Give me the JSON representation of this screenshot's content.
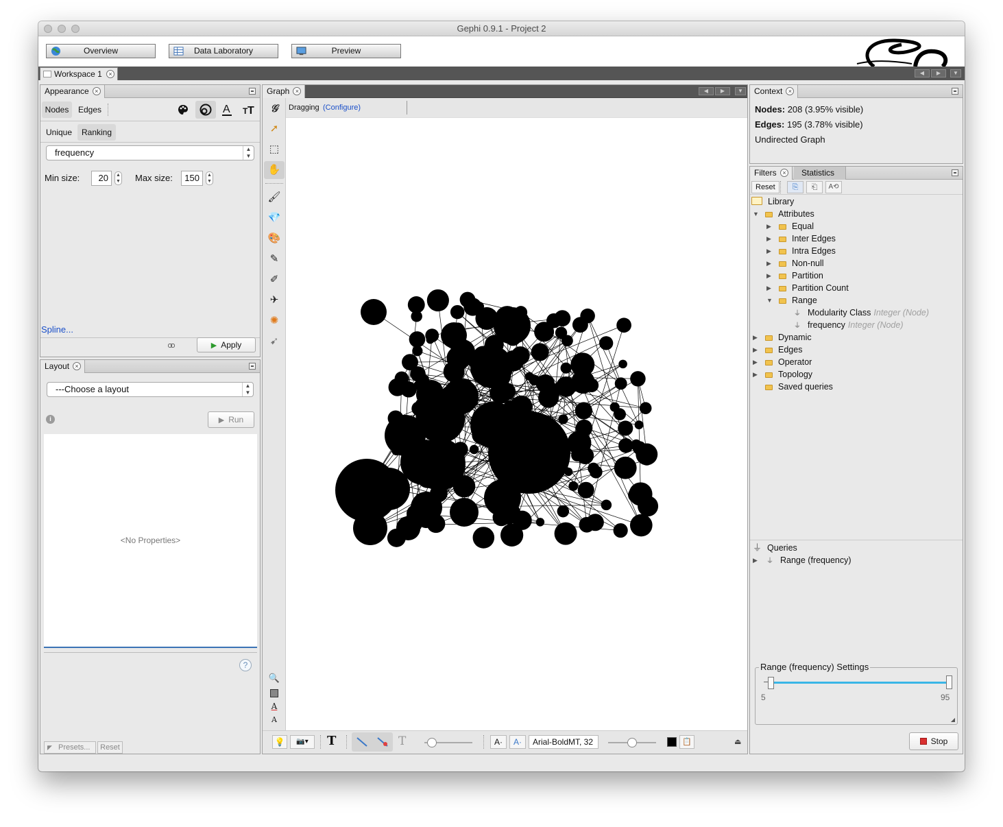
{
  "window": {
    "title": "Gephi 0.9.1 - Project 2"
  },
  "modes": {
    "overview": "Overview",
    "data_laboratory": "Data Laboratory",
    "preview": "Preview"
  },
  "workspace": {
    "tab": "Workspace 1"
  },
  "appearance": {
    "title": "Appearance",
    "tabs": [
      "Nodes",
      "Edges"
    ],
    "subtabs": [
      "Unique",
      "Ranking"
    ],
    "attribute": "frequency",
    "min_label": "Min size:",
    "min_value": "20",
    "max_label": "Max size:",
    "max_value": "150",
    "spline": "Spline...",
    "apply": "Apply",
    "icons": [
      "color-palette-icon",
      "size-icon",
      "label-color-icon",
      "label-size-icon"
    ]
  },
  "layout": {
    "title": "Layout",
    "choose": "---Choose a layout",
    "run": "Run",
    "no_properties": "<No Properties>",
    "presets": "Presets...",
    "reset": "Reset"
  },
  "graph": {
    "title": "Graph",
    "mode": "Dragging",
    "configure": "(Configure)",
    "font": "Arial-BoldMT, 32",
    "node_color": "#000000",
    "edge_color": "#000000"
  },
  "context": {
    "title": "Context",
    "nodes_label": "Nodes:",
    "nodes_value": "208 (3.95% visible)",
    "edges_label": "Edges:",
    "edges_value": "195 (3.78% visible)",
    "graph_type": "Undirected Graph"
  },
  "filters": {
    "tab_filters": "Filters",
    "tab_statistics": "Statistics",
    "reset": "Reset",
    "library": "Library",
    "attributes": "Attributes",
    "attr_children": [
      "Equal",
      "Inter Edges",
      "Intra Edges",
      "Non-null",
      "Partition",
      "Partition Count"
    ],
    "range": "Range",
    "range_children": [
      {
        "name": "Modularity Class",
        "hint": "Integer (Node)"
      },
      {
        "name": "frequency",
        "hint": "Integer (Node)"
      }
    ],
    "other": [
      "Dynamic",
      "Edges",
      "Operator",
      "Topology"
    ],
    "saved": "Saved queries",
    "queries": "Queries",
    "query_item": "Range (frequency)",
    "settings_title": "Range (frequency) Settings",
    "range_min": "5",
    "range_max": "95",
    "stop": "Stop"
  },
  "colors": {
    "accent_link": "#1a4fc9",
    "slider_track": "#3ab6e6",
    "stop_red": "#d93030"
  }
}
